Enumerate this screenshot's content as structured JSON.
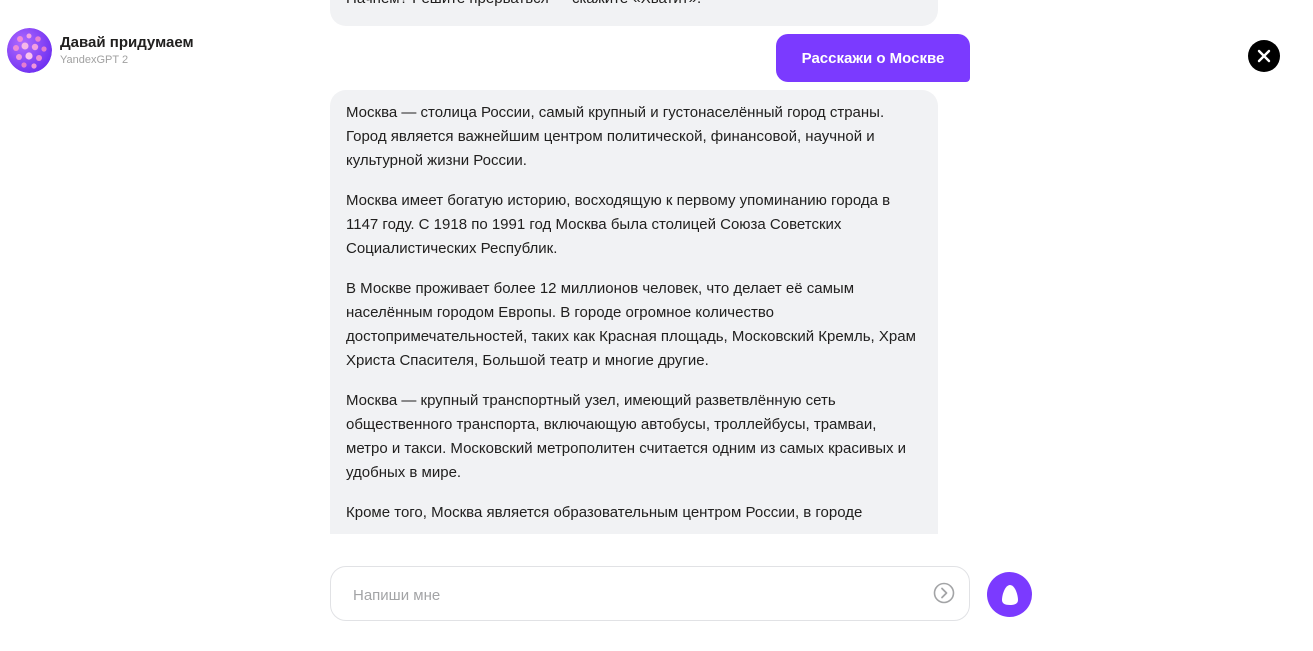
{
  "header": {
    "title": "Давай придумаем",
    "subtitle": "YandexGPT 2"
  },
  "chat": {
    "prev_message_tail": "Начнем? Решите прерваться — скажите «Хватит».",
    "user_message": "Расскажи о Москве",
    "bot_response": [
      "Москва — столица России, самый крупный и густонаселённый город страны. Город является важнейшим центром политической, финансовой, научной и культурной жизни России.",
      "Москва имеет богатую историю, восходящую к первому упоминанию города в 1147 году. С 1918 по 1991 год Москва была столицей Союза Советских Социалистических Республик.",
      "В Москве проживает более 12 миллионов человек, что делает её самым населённым городом Европы. В городе огромное количество достопримечательностей, таких как Красная площадь, Московский Кремль, Храм Христа Спасителя, Большой театр и многие другие.",
      "Москва — крупный транспортный узел, имеющий разветвлённую сеть общественного транспорта, включающую автобусы, троллейбусы, трамваи, метро и такси. Московский метрополитен считается одним из самых красивых и удобных в мире.",
      "Кроме того, Москва является образовательным центром России, в городе"
    ]
  },
  "input": {
    "placeholder": "Напиши мне",
    "value": ""
  },
  "icons": {
    "close": "close-icon",
    "send": "send-arrow-icon",
    "alice": "alice-icon",
    "avatar": "avatar-dots-icon"
  },
  "colors": {
    "accent": "#7b3aff",
    "bubble_bg": "#f1f2f4",
    "text": "#21201f",
    "muted": "#a1a1a1"
  }
}
